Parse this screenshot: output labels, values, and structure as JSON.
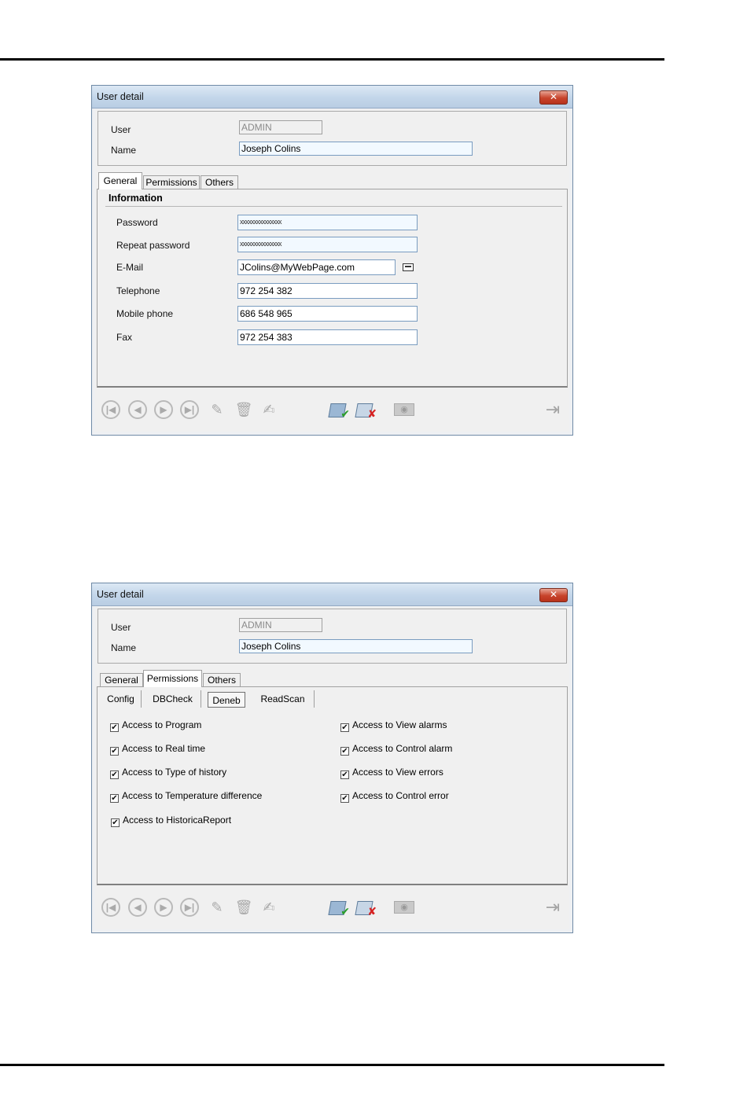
{
  "window_title": "User detail",
  "close_label": "✕",
  "header": {
    "user_label": "User",
    "user_value": "ADMIN",
    "name_label": "Name",
    "name_value": "Joseph Colins"
  },
  "tabs": [
    "General",
    "Permissions",
    "Others"
  ],
  "general": {
    "group_title": "Information",
    "password_label": "Password",
    "password_value": "xxxxxxxxxxxxxxx",
    "repeat_password_label": "Repeat password",
    "repeat_password_value": "xxxxxxxxxxxxxxx",
    "email_label": "E-Mail",
    "email_value": "JColins@MyWebPage.com",
    "telephone_label": "Telephone",
    "telephone_value": "972 254 382",
    "mobile_label": "Mobile phone",
    "mobile_value": "686 548 965",
    "fax_label": "Fax",
    "fax_value": "972 254 383"
  },
  "permissions": {
    "subtabs": [
      "Config",
      "DBCheck",
      "Deneb",
      "ReadScan"
    ],
    "selected_subtab": "Deneb",
    "left": [
      {
        "label": "Access to Program",
        "checked": true
      },
      {
        "label": "Access to Real time",
        "checked": true
      },
      {
        "label": "Access to Type of history",
        "checked": true
      },
      {
        "label": "Access to Temperature difference",
        "checked": true
      },
      {
        "label": "Access to HistoricaReport",
        "checked": true
      }
    ],
    "right": [
      {
        "label": "Access to View alarms",
        "checked": true
      },
      {
        "label": "Access to Control alarm",
        "checked": true
      },
      {
        "label": "Access to View errors",
        "checked": true
      },
      {
        "label": "Access to Control error",
        "checked": true
      }
    ],
    "check_mark": "✔"
  },
  "toolbar_icons": {
    "first": "first-record-icon",
    "prev": "previous-record-icon",
    "next": "next-record-icon",
    "last": "last-record-icon",
    "new": "new-record-icon",
    "delete": "delete-record-icon",
    "edit": "edit-record-icon",
    "accept": "accept-folder-icon",
    "cancel": "cancel-folder-icon",
    "view": "view-icon",
    "exit": "exit-door-icon"
  }
}
